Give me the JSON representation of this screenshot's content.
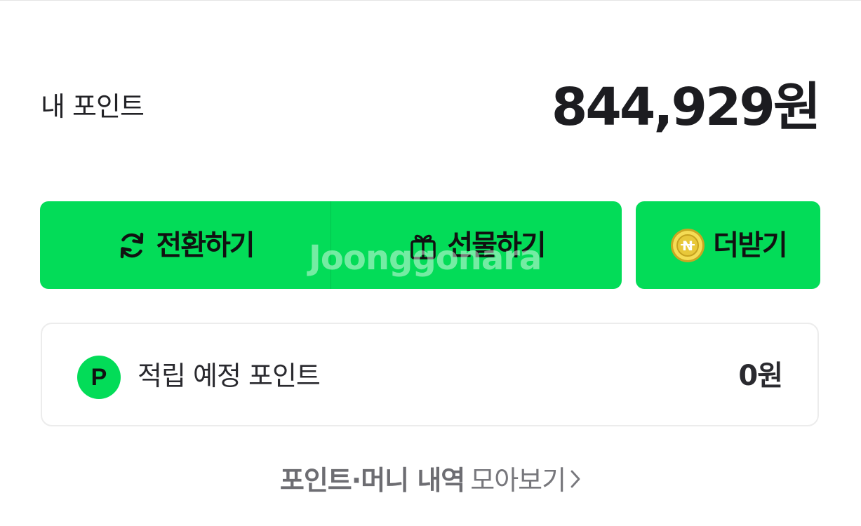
{
  "balance": {
    "label": "내 포인트",
    "amount": "844,929원"
  },
  "actions": {
    "convert_label": "전환하기",
    "gift_label": "선물하기",
    "earn_more_label": "더받기"
  },
  "watermark": "Joonggonara",
  "pending": {
    "badge": "P",
    "label": "적립 예정 포인트",
    "value": "0원"
  },
  "history_link": {
    "strong": "포인트·머니 내역",
    "normal": "모아보기"
  },
  "colors": {
    "accent": "#03dc58",
    "text": "#1e1e23",
    "muted": "#77777c"
  },
  "icons": {
    "convert": "refresh-icon",
    "gift": "gift-icon",
    "coin": "naver-coin-icon",
    "chevron": "chevron-right-icon"
  }
}
